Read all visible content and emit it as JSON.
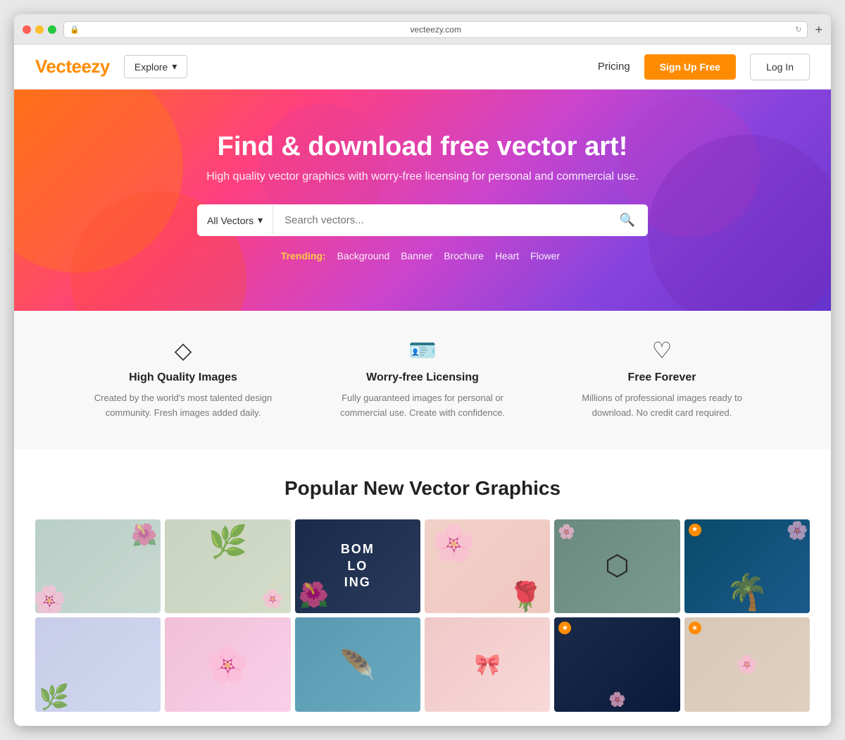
{
  "browser": {
    "url": "vecteezy.com",
    "plus_label": "+"
  },
  "navbar": {
    "logo": "Vecteezy",
    "explore_label": "Explore",
    "explore_arrow": "▾",
    "pricing_label": "Pricing",
    "signup_label": "Sign Up Free",
    "login_label": "Log In"
  },
  "hero": {
    "title": "Find & download free vector art!",
    "subtitle": "High quality vector graphics with worry-free licensing for personal and commercial use.",
    "search_filter": "All Vectors",
    "search_filter_arrow": "▾",
    "search_placeholder": "Search vectors...",
    "search_icon": "🔍",
    "trending_label": "Trending:",
    "trending_items": [
      "Background",
      "Banner",
      "Brochure",
      "Heart",
      "Flower"
    ]
  },
  "features": [
    {
      "icon": "◇",
      "title": "High Quality Images",
      "description": "Created by the world's most talented design community. Fresh images added daily."
    },
    {
      "icon": "▭",
      "title": "Worry-free Licensing",
      "description": "Fully guaranteed images for personal or commercial use. Create with confidence."
    },
    {
      "icon": "♡",
      "title": "Free Forever",
      "description": "Millions of professional images ready to download. No credit card required."
    }
  ],
  "gallery": {
    "section_title": "Popular New Vector Graphics",
    "items": [
      {
        "id": 1,
        "style": "card-1",
        "has_badge": false
      },
      {
        "id": 2,
        "style": "card-2",
        "has_badge": false
      },
      {
        "id": 3,
        "style": "card-3",
        "has_badge": false
      },
      {
        "id": 4,
        "style": "card-4",
        "has_badge": false
      },
      {
        "id": 5,
        "style": "card-5",
        "has_badge": false
      },
      {
        "id": 6,
        "style": "card-6",
        "has_badge": true
      },
      {
        "id": 7,
        "style": "card-7",
        "has_badge": false
      },
      {
        "id": 8,
        "style": "card-8",
        "has_badge": false
      },
      {
        "id": 9,
        "style": "card-9",
        "has_badge": false
      },
      {
        "id": 10,
        "style": "card-10",
        "has_badge": false
      },
      {
        "id": 11,
        "style": "card-11",
        "has_badge": false
      },
      {
        "id": 12,
        "style": "card-12",
        "has_badge": true
      }
    ]
  }
}
